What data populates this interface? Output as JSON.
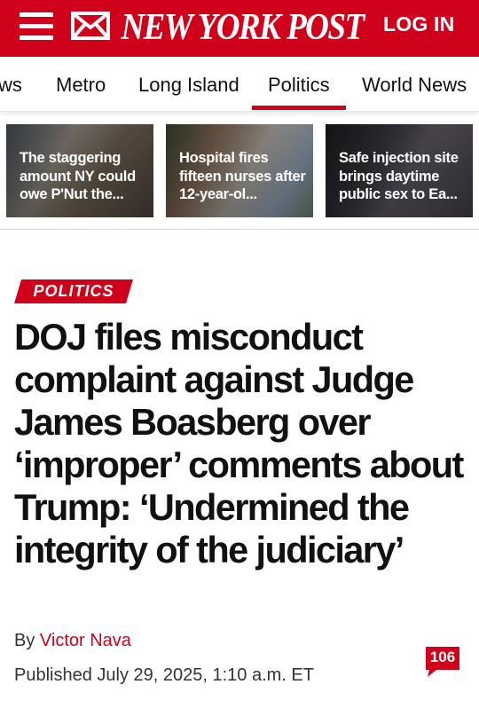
{
  "header": {
    "logo_text": "NEW YORK POST",
    "login_label": "LOG IN",
    "brand_color": "#d0021b"
  },
  "nav": {
    "items": [
      {
        "label": "ws"
      },
      {
        "label": "Metro"
      },
      {
        "label": "Long Island"
      },
      {
        "label": "Politics",
        "active": true
      },
      {
        "label": "World News"
      }
    ]
  },
  "trending": [
    {
      "title": "The staggering amount NY could owe P'Nut the..."
    },
    {
      "title": "Hospital fires fifteen nurses after 12-year-ol..."
    },
    {
      "title": "Safe injection site brings daytime public sex to Ea..."
    }
  ],
  "article": {
    "section_badge": "POLITICS",
    "headline": "DOJ files misconduct complaint against Judge James Boasberg over ‘improper’ comments about Trump: ‘Undermined the integrity of the judiciary’",
    "byline_prefix": "By ",
    "author": "Victor Nava",
    "published": "Published July 29, 2025, 1:10 a.m. ET",
    "comment_count": "106"
  }
}
